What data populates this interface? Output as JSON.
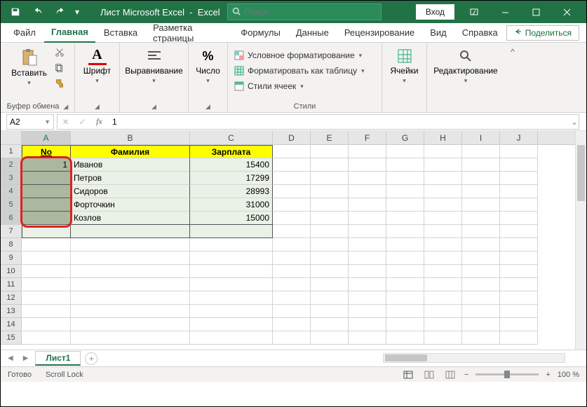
{
  "title": {
    "doc": "Лист Microsoft Excel",
    "app": "Excel"
  },
  "search": {
    "placeholder": "Поиск"
  },
  "login": {
    "label": "Вход"
  },
  "tabs": {
    "file": "Файл",
    "home": "Главная",
    "insert": "Вставка",
    "layout": "Разметка страницы",
    "formulas": "Формулы",
    "data": "Данные",
    "review": "Рецензирование",
    "view": "Вид",
    "help": "Справка"
  },
  "share": {
    "label": "Поделиться"
  },
  "ribbon": {
    "clipboard": {
      "paste": "Вставить",
      "group": "Буфер обмена"
    },
    "font": {
      "btn": "Шрифт",
      "group": ""
    },
    "align": {
      "btn": "Выравнивание",
      "group": ""
    },
    "number": {
      "btn": "Число",
      "group": ""
    },
    "styles": {
      "cond": "Условное форматирование",
      "table": "Форматировать как таблицу",
      "cell": "Стили ячеек",
      "group": "Стили"
    },
    "cells": {
      "btn": "Ячейки"
    },
    "editing": {
      "btn": "Редактирование"
    }
  },
  "namebox": {
    "ref": "A2"
  },
  "formula": {
    "value": "1"
  },
  "columns": [
    "A",
    "B",
    "C",
    "D",
    "E",
    "F",
    "G",
    "H",
    "I",
    "J"
  ],
  "col_widths": {
    "A": 70,
    "B": 170,
    "C": 118,
    "rest": 54
  },
  "headers": {
    "col_a": "No",
    "col_b": "Фамилия",
    "col_c": "Зарплата"
  },
  "data_rows": [
    {
      "n": "1",
      "name": "Иванов",
      "salary": "15400"
    },
    {
      "n": "",
      "name": "Петров",
      "salary": "17299"
    },
    {
      "n": "",
      "name": "Сидоров",
      "salary": "28993"
    },
    {
      "n": "",
      "name": "Форточкин",
      "salary": "31000"
    },
    {
      "n": "",
      "name": "Козлов",
      "salary": "15000"
    }
  ],
  "row_count": 15,
  "sheets": {
    "name": "Лист1"
  },
  "statusbar": {
    "ready": "Готово",
    "scroll": "Scroll Lock",
    "zoom": "100 %"
  }
}
